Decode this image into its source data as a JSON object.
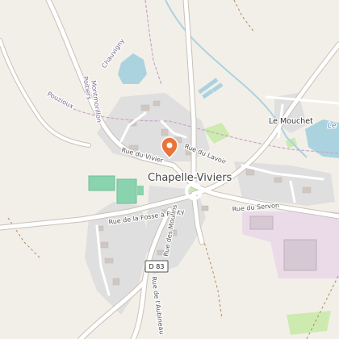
{
  "map": {
    "place": "Chapelle-Viviers",
    "hamlet": "Le Mouchet",
    "water_label": "Le",
    "localities": [
      "Chauvigny",
      "Poitiers",
      "Montmorillon",
      "Pouzioux"
    ],
    "streets": {
      "vivier": "Rue du Vivier",
      "lavoir": "Rue du Lavoir",
      "fosse": "Rue de la Fosse à Ponty",
      "moulins": "Rue des Moulins",
      "servon": "Rue du Servon",
      "aubineau": "Rue de l'Aubineau"
    },
    "road_ref": "D 83",
    "marker": {
      "icon": "location-pin-icon",
      "color": "#e8743b"
    },
    "colors": {
      "background": "#f2efe9",
      "water": "#aad3df",
      "residential": "#dcdcdc",
      "industrial": "#ebdbe8",
      "sports": "#8ad3af",
      "grass": "#cdebb0",
      "rail": "#c9a6c9"
    }
  }
}
